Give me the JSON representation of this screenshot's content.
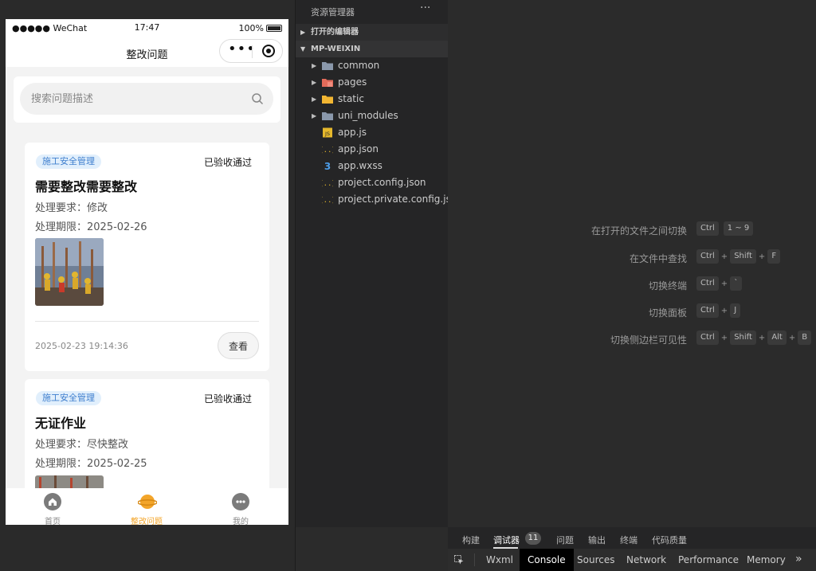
{
  "simulator": {
    "status_bar": {
      "carrier": "●●●●● WeChat",
      "time": "17:47",
      "battery": "100%"
    },
    "nav_title": "整改问题",
    "search_placeholder": "搜索问题描述",
    "cards": [
      {
        "tag": "施工安全管理",
        "status": "已验收通过",
        "title": "需要整改需要整改",
        "requirement": "处理要求：修改",
        "deadline": "处理期限：2025-02-26",
        "time": "2025-02-23 19:14:36",
        "view_label": "查看"
      },
      {
        "tag": "施工安全管理",
        "status": "已验收通过",
        "title": "无证作业",
        "requirement": "处理要求：尽快整改",
        "deadline": "处理期限：2025-02-25"
      }
    ],
    "tabbar": [
      {
        "label": "首页",
        "icon": "home-icon"
      },
      {
        "label": "整改问题",
        "icon": "planet-icon",
        "active": true
      },
      {
        "label": "我的",
        "icon": "user-dots-icon"
      }
    ],
    "accent": "#f3a52a"
  },
  "explorer": {
    "title": "资源管理器",
    "more": "···",
    "open_editors": "打开的编辑器",
    "project": "MP-WEIXIN",
    "items": [
      {
        "name": "common",
        "type": "folder",
        "icon": "folder-icon"
      },
      {
        "name": "pages",
        "type": "folder",
        "icon": "folder-pages-icon"
      },
      {
        "name": "static",
        "type": "folder",
        "icon": "folder-static-icon"
      },
      {
        "name": "uni_modules",
        "type": "folder",
        "icon": "folder-icon"
      },
      {
        "name": "app.js",
        "type": "file",
        "icon": "js-file-icon",
        "icon_text": "JS"
      },
      {
        "name": "app.json",
        "type": "file",
        "icon": "json-file-icon",
        "icon_text": "{..}"
      },
      {
        "name": "app.wxss",
        "type": "file",
        "icon": "css-file-icon",
        "icon_text": "3"
      },
      {
        "name": "project.config.json",
        "type": "file",
        "icon": "json-file-icon",
        "icon_text": "{..}"
      },
      {
        "name": "project.private.config.js...",
        "type": "file",
        "icon": "json-file-icon",
        "icon_text": "{..}"
      }
    ]
  },
  "shortcuts": [
    {
      "label": "在打开的文件之间切换",
      "keys": [
        "Ctrl",
        "1 ~ 9"
      ]
    },
    {
      "label": "在文件中查找",
      "keys": [
        "Ctrl",
        "Shift",
        "F"
      ]
    },
    {
      "label": "切换终端",
      "keys": [
        "Ctrl",
        "`"
      ]
    },
    {
      "label": "切换面板",
      "keys": [
        "Ctrl",
        "J"
      ]
    },
    {
      "label": "切换侧边栏可见性",
      "keys": [
        "Ctrl",
        "Shift",
        "Alt",
        "B"
      ]
    }
  ],
  "panel": {
    "tabs": [
      "构建",
      "调试器",
      "问题",
      "输出",
      "终端",
      "代码质量"
    ],
    "active_tab": "调试器",
    "badge": "11"
  },
  "devtools": {
    "tabs": [
      "Wxml",
      "Console",
      "Sources",
      "Network",
      "Performance",
      "Memory"
    ],
    "active_tab": "Console",
    "more": "»"
  }
}
